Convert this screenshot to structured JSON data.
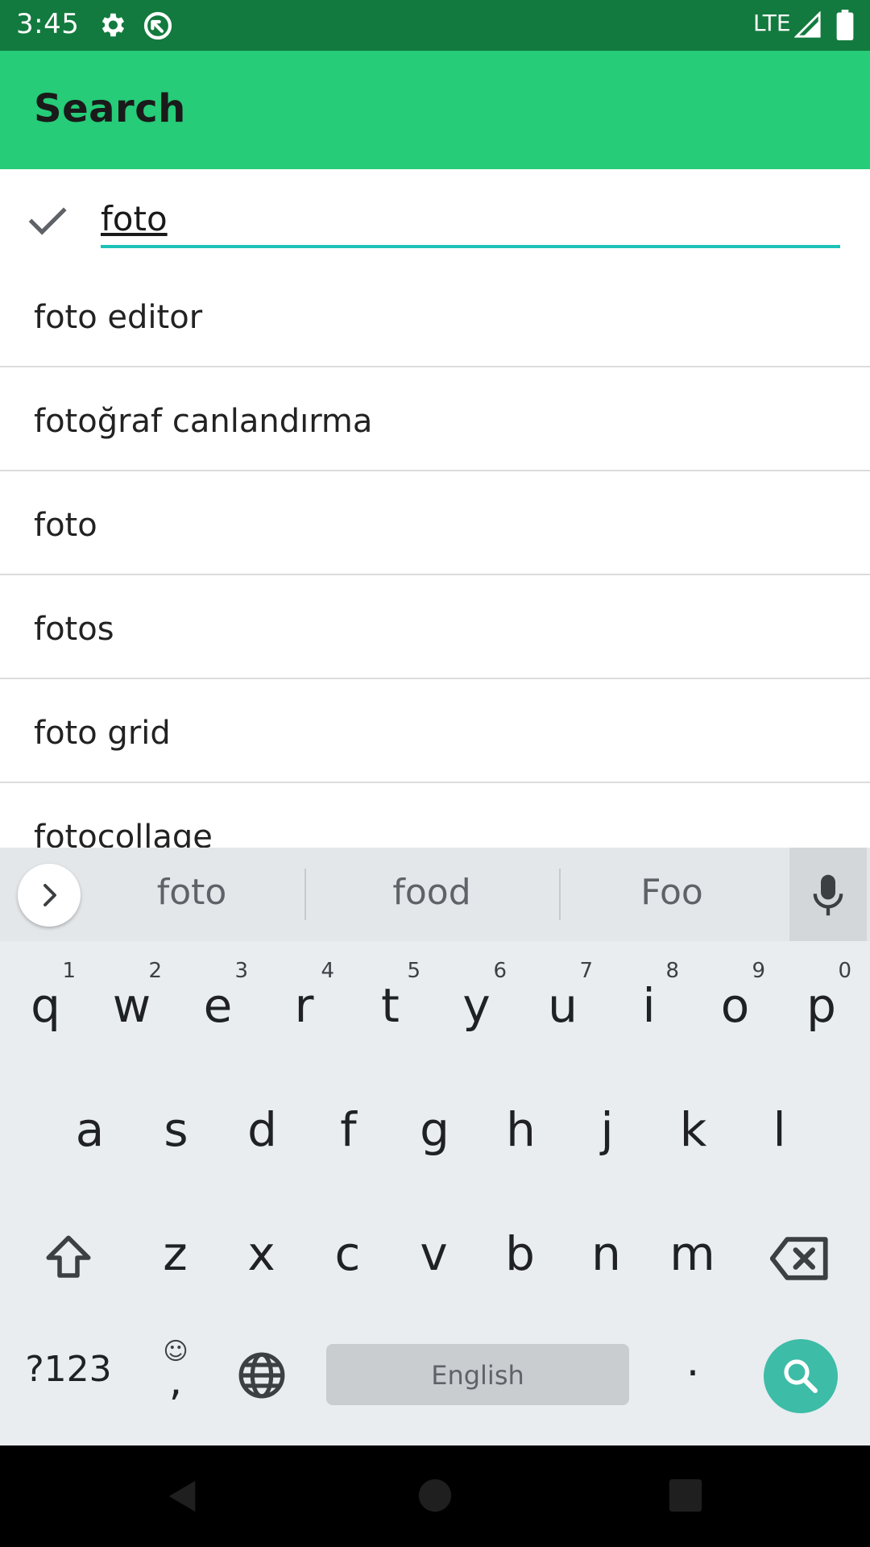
{
  "status_bar": {
    "time": "3:45",
    "network": "LTE",
    "icons": [
      "gear-icon",
      "sync-icon",
      "signal-icon",
      "battery-icon"
    ]
  },
  "app_bar": {
    "title": "Search",
    "color": "#26cc78"
  },
  "search": {
    "value": "foto",
    "underline_color": "#1cc2b8"
  },
  "suggestions": [
    "foto editor",
    "fotoğraf canlandırma",
    "foto",
    "fotos",
    "foto grid",
    "fotocollage"
  ],
  "keyboard": {
    "word_suggestions": [
      "foto",
      "food",
      "Foo"
    ],
    "row1": [
      {
        "ch": "q",
        "num": "1"
      },
      {
        "ch": "w",
        "num": "2"
      },
      {
        "ch": "e",
        "num": "3"
      },
      {
        "ch": "r",
        "num": "4"
      },
      {
        "ch": "t",
        "num": "5"
      },
      {
        "ch": "y",
        "num": "6"
      },
      {
        "ch": "u",
        "num": "7"
      },
      {
        "ch": "i",
        "num": "8"
      },
      {
        "ch": "o",
        "num": "9"
      },
      {
        "ch": "p",
        "num": "0"
      }
    ],
    "row2": [
      "a",
      "s",
      "d",
      "f",
      "g",
      "h",
      "j",
      "k",
      "l"
    ],
    "row3": [
      "z",
      "x",
      "c",
      "v",
      "b",
      "n",
      "m"
    ],
    "symbols_label": "?123",
    "comma_label": ",",
    "emoji_label": "☺",
    "space_label": "English",
    "period_label": ".",
    "search_key_color": "#3dbca7"
  }
}
